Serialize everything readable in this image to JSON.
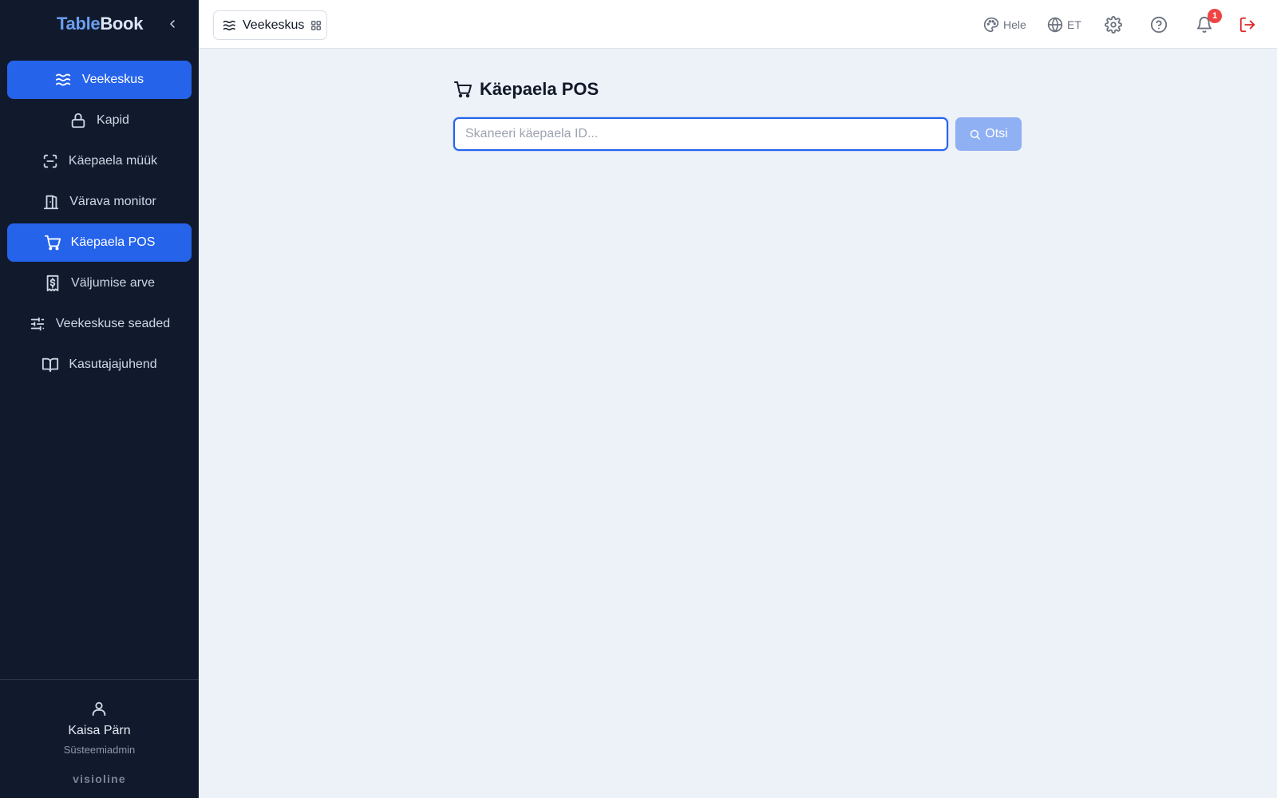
{
  "brand": {
    "part1": "Table",
    "part2": "Book"
  },
  "sidebar": {
    "items": [
      {
        "label": "Veekeskus",
        "icon": "waves-icon",
        "active": true
      },
      {
        "label": "Kapid",
        "icon": "lock-icon",
        "active": false
      },
      {
        "label": "Käepaela müük",
        "icon": "scan-icon",
        "active": false
      },
      {
        "label": "Värava monitor",
        "icon": "door-icon",
        "active": false
      },
      {
        "label": "Käepaela POS",
        "icon": "cart-icon",
        "active": true
      },
      {
        "label": "Väljumise arve",
        "icon": "receipt-icon",
        "active": false
      },
      {
        "label": "Veekeskuse seaded",
        "icon": "sliders-icon",
        "active": false
      },
      {
        "label": "Kasutajajuhend",
        "icon": "book-icon",
        "active": false
      }
    ],
    "user": {
      "name": "Kaisa Pärn",
      "role": "Süsteemiadmin"
    },
    "footer_logo": "visioline"
  },
  "topbar": {
    "workspace": {
      "label": "Veekeskus",
      "icon": "waves-icon",
      "trailing_icon": "grid-icon"
    },
    "theme": {
      "label": "Hele",
      "icon": "palette-icon"
    },
    "language": {
      "label": "ET",
      "icon": "globe-icon"
    },
    "settings_icon": "gear-icon",
    "help_icon": "help-circle-icon",
    "notifications": {
      "icon": "bell-icon",
      "count": "1"
    },
    "logout_icon": "logout-icon"
  },
  "main": {
    "title": "Käepaela POS",
    "title_icon": "cart-icon",
    "search": {
      "placeholder": "Skaneeri käepaela ID...",
      "value": ""
    },
    "search_button": "Otsi"
  },
  "colors": {
    "sidebar_bg": "#111a2d",
    "accent": "#2563eb",
    "main_bg": "#edf1f8",
    "badge": "#ef4444",
    "logout": "#dc2626"
  }
}
